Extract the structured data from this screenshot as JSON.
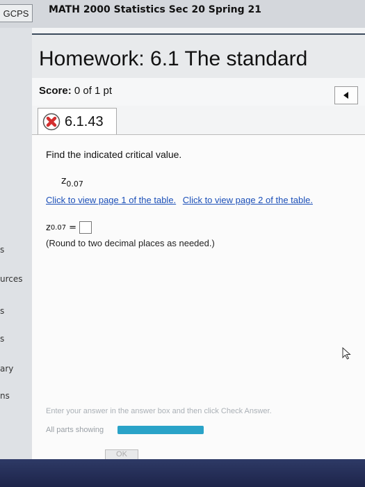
{
  "header": {
    "nav_label": "GCPS",
    "course_title": "MATH 2000 Statistics Sec 20 Spring 21"
  },
  "sidebar": {
    "items": [
      "s",
      "urces",
      "s",
      "s",
      "ary",
      "ns"
    ]
  },
  "homework": {
    "title": "Homework: 6.1 The standard",
    "score_label": "Score:",
    "score_value": "0 of 1 pt"
  },
  "question": {
    "number": "6.1.43",
    "status_icon": "incorrect-x-icon",
    "instruction": "Find the indicated critical value.",
    "z_symbol": "z",
    "z_subscript": "0.07",
    "link_page1": "Click to view page 1 of the table.",
    "link_page2": "Click to view page 2 of the table.",
    "answer_equals": "=",
    "answer_value": "",
    "round_note": "(Round to two decimal places as needed.)"
  },
  "footer": {
    "hint": "Enter your answer in the answer box and then click Check Answer.",
    "parts_label": "All parts showing",
    "progress_fraction": 1.0,
    "ok_label": "OK"
  },
  "colors": {
    "link": "#1b4fb8",
    "error_red": "#d32f2f",
    "progress": "#2aa3c8",
    "header_border": "#3b4a5c"
  }
}
